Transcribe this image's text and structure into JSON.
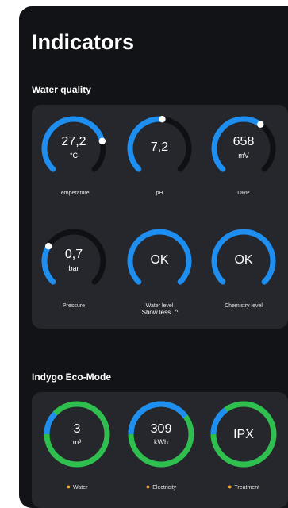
{
  "header": {
    "title": "Indicators"
  },
  "water_quality": {
    "label": "Water quality",
    "gauges": [
      {
        "value": "27,2",
        "unit": "°C",
        "caption": "Temperature",
        "fill": 0.78
      },
      {
        "value": "7,2",
        "unit": "",
        "caption": "pH",
        "fill": 0.52
      },
      {
        "value": "658",
        "unit": "mV",
        "caption": "ORP",
        "fill": 0.63
      },
      {
        "value": "0,7",
        "unit": "bar",
        "caption": "Pressure",
        "fill": 0.28
      },
      {
        "value": "OK",
        "unit": "",
        "caption": "Water level",
        "fill": 1.0
      },
      {
        "value": "OK",
        "unit": "",
        "caption": "Chemistry level",
        "fill": 1.0
      }
    ],
    "show_less": "Show less"
  },
  "eco_mode": {
    "label": "Indygo Eco-Mode",
    "rings": [
      {
        "value": "3",
        "unit": "m³",
        "caption": "Water",
        "blue_share": 0.12
      },
      {
        "value": "309",
        "unit": "kWh",
        "caption": "Electricity",
        "blue_share": 0.4
      },
      {
        "value": "IPX",
        "unit": "",
        "caption": "Treatment",
        "blue_share": 0.15
      }
    ]
  },
  "colors": {
    "accent_blue": "#1e8ff0",
    "track_dark": "#0f1013",
    "eco_green": "#2fbf4f",
    "card_bg": "#25272c",
    "panel_bg": "#121316"
  }
}
